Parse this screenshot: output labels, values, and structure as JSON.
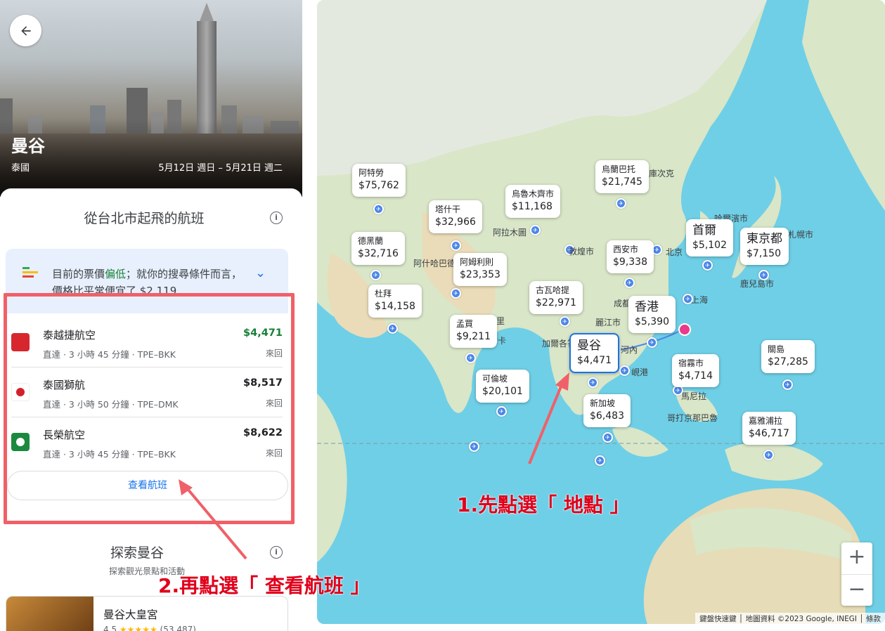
{
  "hero": {
    "city": "曼谷",
    "country": "泰國",
    "dates": "5月12日 週日 – 5月21日 週二"
  },
  "flights_section": {
    "title": "從台北市起飛的航班",
    "price_insight_prefix": "目前的票價",
    "price_insight_level": "偏低",
    "price_insight_suffix": "；就你的搜尋條件而言，價格比平常便宜了 $2,119",
    "flights": [
      {
        "airline": "泰越捷航空",
        "details": "直達 · 3 小時 45 分鐘 · TPE–BKK",
        "price": "$4,471",
        "trip": "來回",
        "cheapest": true,
        "logo_color": "#d8262f"
      },
      {
        "airline": "泰國獅航",
        "details": "直達 · 3 小時 50 分鐘 · TPE–DMK",
        "price": "$8,517",
        "trip": "來回",
        "cheapest": false,
        "logo_color": "#d4202a"
      },
      {
        "airline": "長榮航空",
        "details": "直達 · 3 小時 45 分鐘 · TPE–BKK",
        "price": "$8,622",
        "trip": "來回",
        "cheapest": false,
        "logo_color": "#1b8a3e"
      }
    ],
    "view_flights": "查看航班"
  },
  "explore": {
    "title": "探索曼谷",
    "subtitle": "探索觀光景點和活動",
    "place_name": "曼谷大皇宮",
    "rating": "4.5",
    "stars": "★★★★★",
    "reviews": "(53,487)"
  },
  "map": {
    "destinations": [
      {
        "name": "阿特勞",
        "price": "$75,762"
      },
      {
        "name": "烏蘭巴托",
        "price": "$21,745"
      },
      {
        "name": "塔什干",
        "price": "$32,966"
      },
      {
        "name": "烏魯木齊市",
        "price": "$11,168"
      },
      {
        "name": "德黑蘭",
        "price": "$32,716"
      },
      {
        "name": "首爾",
        "price": "$5,102"
      },
      {
        "name": "東京都",
        "price": "$7,150"
      },
      {
        "name": "阿姆利則",
        "price": "$23,353"
      },
      {
        "name": "西安市",
        "price": "$9,338"
      },
      {
        "name": "杜拜",
        "price": "$14,158"
      },
      {
        "name": "古瓦哈提",
        "price": "$22,971"
      },
      {
        "name": "香港",
        "price": "$5,390"
      },
      {
        "name": "孟買",
        "price": "$9,211"
      },
      {
        "name": "曼谷",
        "price": "$4,471"
      },
      {
        "name": "關島",
        "price": "$27,285"
      },
      {
        "name": "宿霧市",
        "price": "$4,714"
      },
      {
        "name": "可倫坡",
        "price": "$20,101"
      },
      {
        "name": "新加坡",
        "price": "$6,483"
      },
      {
        "name": "嘉雅浦拉",
        "price": "$46,717"
      }
    ],
    "place_labels": [
      "敦煌市",
      "北京",
      "上海",
      "成都",
      "麗江市",
      "河內",
      "峴港",
      "加爾各答",
      "阿拉木圖",
      "阿什哈巴德",
      "德里",
      "達卡",
      "哈爾濱市",
      "鹿兒島市",
      "札幌市",
      "馬尼拉",
      "哥打京那巴魯",
      "伊爾庫次克"
    ],
    "zoom_in": "+",
    "zoom_out": "−",
    "attribution": "鍵盤快速鍵 │ 地圖資料 ©2023 Google, INEGI │ 條款"
  },
  "annotations": {
    "step1": "1.先點選「 地點 」",
    "step2": "2.再點選「 查看航班 」",
    "color": "#e0001b"
  }
}
